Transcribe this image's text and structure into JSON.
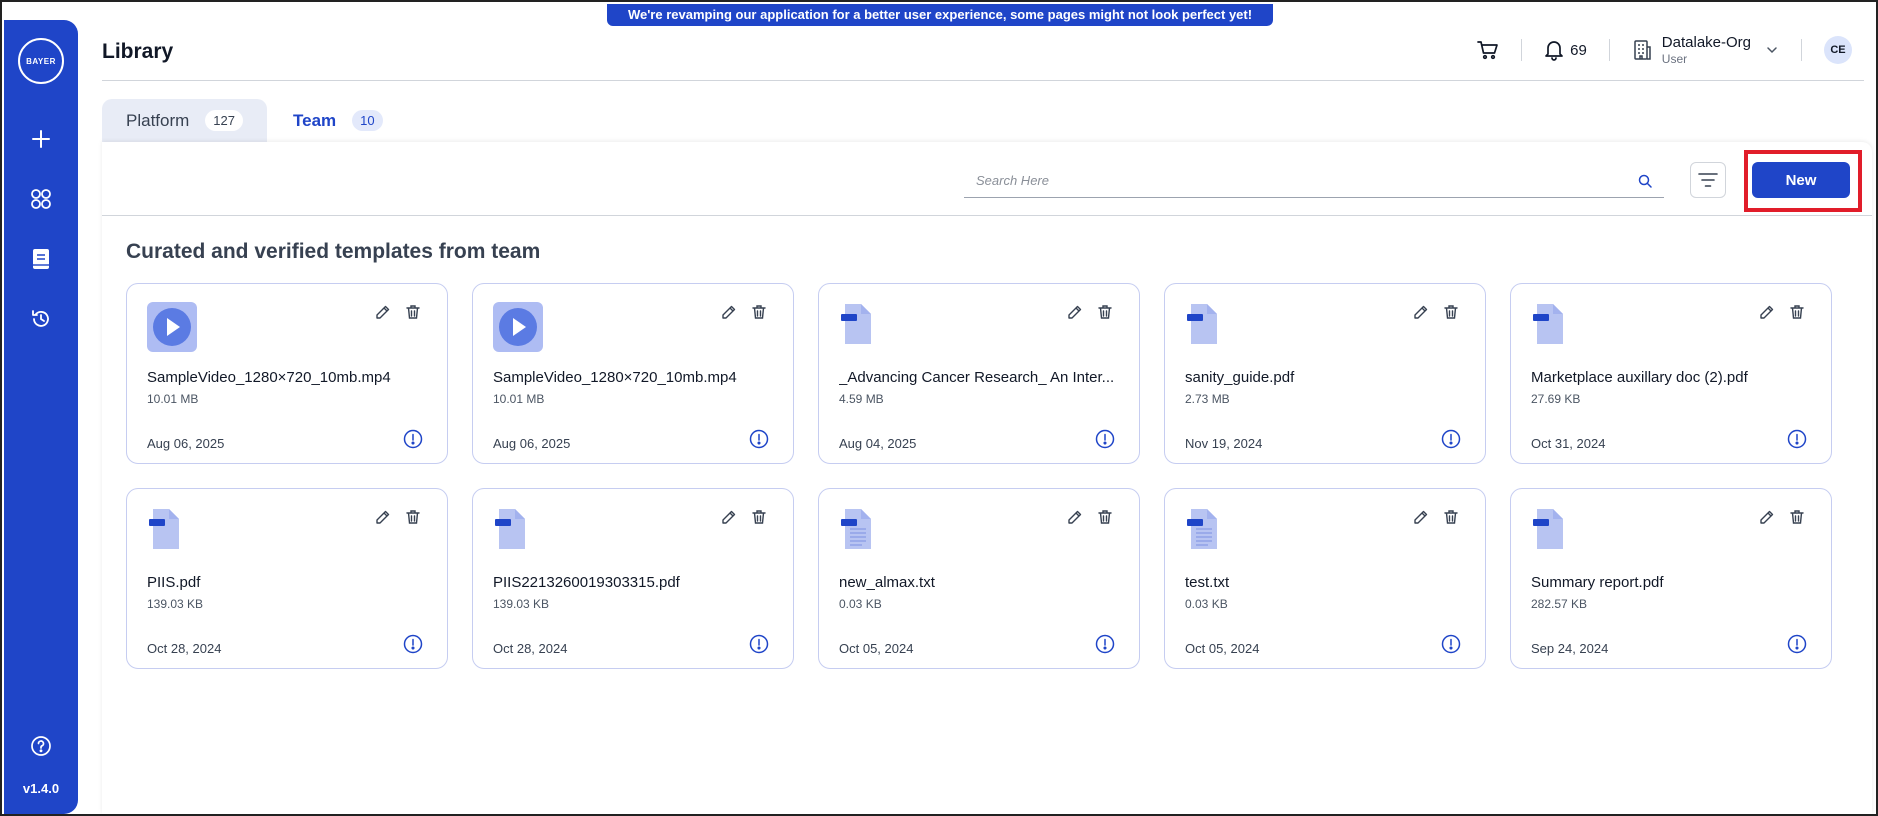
{
  "banner": {
    "text": "We're revamping our application for a better user experience, some pages might not look perfect yet!"
  },
  "sidebar": {
    "logo_text": "BAYER",
    "logo_vertical": "BAYER",
    "items": [
      {
        "name": "add",
        "icon": "plus-icon"
      },
      {
        "name": "apps",
        "icon": "grid-icon"
      },
      {
        "name": "library",
        "icon": "book-icon"
      },
      {
        "name": "history",
        "icon": "history-icon"
      }
    ],
    "help_icon": "help-icon",
    "version": "v1.4.0"
  },
  "header": {
    "title": "Library",
    "notification_count": "69",
    "org_name": "Datalake-Org",
    "org_role": "User",
    "avatar_initials": "CE"
  },
  "tabs": [
    {
      "label": "Platform",
      "count": "127",
      "active": false
    },
    {
      "label": "Team",
      "count": "10",
      "active": true
    }
  ],
  "toolbar": {
    "search_placeholder": "Search Here",
    "new_label": "New"
  },
  "section_title": "Curated and verified templates from team",
  "files": [
    {
      "type": "video",
      "name": "SampleVideo_1280×720_10mb.mp4",
      "size": "10.01 MB",
      "date": "Aug 06, 2025"
    },
    {
      "type": "video",
      "name": "SampleVideo_1280×720_10mb.mp4",
      "size": "10.01 MB",
      "date": "Aug 06, 2025"
    },
    {
      "type": "pdf",
      "name": "_Advancing Cancer Research_ An Inter...",
      "size": "4.59 MB",
      "date": "Aug 04, 2025"
    },
    {
      "type": "pdf",
      "name": "sanity_guide.pdf",
      "size": "2.73 MB",
      "date": "Nov 19, 2024"
    },
    {
      "type": "pdf",
      "name": "Marketplace auxillary doc (2).pdf",
      "size": "27.69 KB",
      "date": "Oct 31, 2024"
    },
    {
      "type": "pdf",
      "name": "PIIS.pdf",
      "size": "139.03 KB",
      "date": "Oct 28, 2024"
    },
    {
      "type": "pdf",
      "name": "PIIS2213260019303315.pdf",
      "size": "139.03 KB",
      "date": "Oct 28, 2024"
    },
    {
      "type": "txt",
      "name": "new_almax.txt",
      "size": "0.03 KB",
      "date": "Oct 05, 2024"
    },
    {
      "type": "txt",
      "name": "test.txt",
      "size": "0.03 KB",
      "date": "Oct 05, 2024"
    },
    {
      "type": "pdf",
      "name": "Summary report.pdf",
      "size": "282.57 KB",
      "date": "Sep 24, 2024"
    }
  ],
  "colors": {
    "brand": "#1f45c8",
    "highlight": "#e11d2a",
    "card_border": "#c6cdf1",
    "file_icon": "#b8c4f2"
  }
}
